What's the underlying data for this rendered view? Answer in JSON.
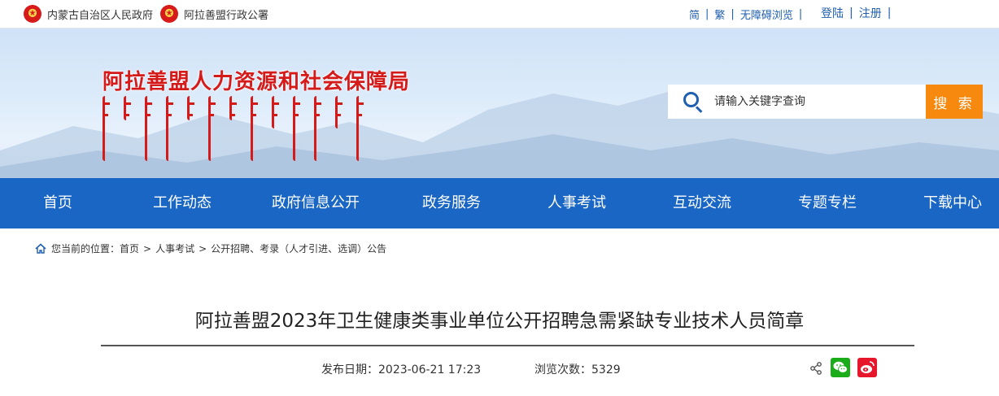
{
  "topbar": {
    "gov_links": [
      "内蒙古自治区人民政府",
      "阿拉善盟行政公署"
    ],
    "simplified": "简",
    "traditional": "繁",
    "accessible": "无障碍浏览",
    "login": "登陆",
    "register": "注册",
    "separator": "|"
  },
  "header": {
    "site_title": "阿拉善盟人力资源和社会保障局",
    "search_placeholder": "请输入关键字查询",
    "search_button": "搜 索"
  },
  "nav": {
    "items": [
      "首页",
      "工作动态",
      "政府信息公开",
      "政务服务",
      "人事考试",
      "互动交流",
      "专题专栏",
      "下载中心"
    ]
  },
  "breadcrumb": {
    "prefix": "您当前的位置：",
    "items": [
      "首页",
      "人事考试",
      "公开招聘、考录（人才引进、选调）公告"
    ],
    "separator": ">"
  },
  "article": {
    "title": "阿拉善盟2023年卫生健康类事业单位公开招聘急需紧缺专业技术人员简章",
    "publish_label": "发布日期：",
    "publish_date": "2023-06-21 17:23",
    "views_label": "浏览次数：",
    "views": "5329"
  },
  "colors": {
    "nav_bg": "#1966c4",
    "title_red": "#d51a1a",
    "search_button": "#f7890f",
    "link_blue": "#1f5fb0",
    "wechat": "#1aad19",
    "weibo": "#e6162d"
  },
  "icons": [
    "national-emblem-icon",
    "search-icon",
    "home-icon",
    "share-icon",
    "wechat-icon",
    "weibo-icon"
  ]
}
